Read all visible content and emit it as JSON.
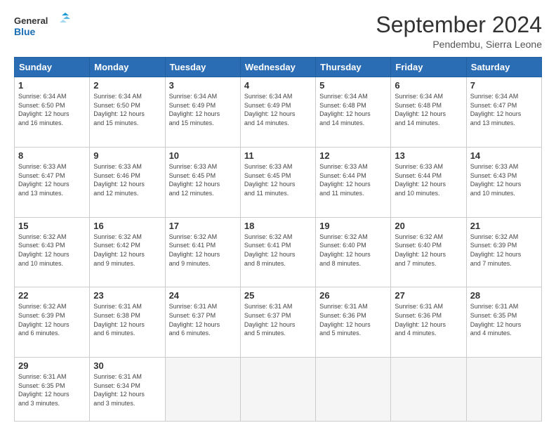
{
  "header": {
    "logo_line1": "General",
    "logo_line2": "Blue",
    "month": "September 2024",
    "location": "Pendembu, Sierra Leone"
  },
  "weekdays": [
    "Sunday",
    "Monday",
    "Tuesday",
    "Wednesday",
    "Thursday",
    "Friday",
    "Saturday"
  ],
  "weeks": [
    [
      {
        "day": "1",
        "info": "Sunrise: 6:34 AM\nSunset: 6:50 PM\nDaylight: 12 hours\nand 16 minutes."
      },
      {
        "day": "2",
        "info": "Sunrise: 6:34 AM\nSunset: 6:50 PM\nDaylight: 12 hours\nand 15 minutes."
      },
      {
        "day": "3",
        "info": "Sunrise: 6:34 AM\nSunset: 6:49 PM\nDaylight: 12 hours\nand 15 minutes."
      },
      {
        "day": "4",
        "info": "Sunrise: 6:34 AM\nSunset: 6:49 PM\nDaylight: 12 hours\nand 14 minutes."
      },
      {
        "day": "5",
        "info": "Sunrise: 6:34 AM\nSunset: 6:48 PM\nDaylight: 12 hours\nand 14 minutes."
      },
      {
        "day": "6",
        "info": "Sunrise: 6:34 AM\nSunset: 6:48 PM\nDaylight: 12 hours\nand 14 minutes."
      },
      {
        "day": "7",
        "info": "Sunrise: 6:34 AM\nSunset: 6:47 PM\nDaylight: 12 hours\nand 13 minutes."
      }
    ],
    [
      {
        "day": "8",
        "info": "Sunrise: 6:33 AM\nSunset: 6:47 PM\nDaylight: 12 hours\nand 13 minutes."
      },
      {
        "day": "9",
        "info": "Sunrise: 6:33 AM\nSunset: 6:46 PM\nDaylight: 12 hours\nand 12 minutes."
      },
      {
        "day": "10",
        "info": "Sunrise: 6:33 AM\nSunset: 6:45 PM\nDaylight: 12 hours\nand 12 minutes."
      },
      {
        "day": "11",
        "info": "Sunrise: 6:33 AM\nSunset: 6:45 PM\nDaylight: 12 hours\nand 11 minutes."
      },
      {
        "day": "12",
        "info": "Sunrise: 6:33 AM\nSunset: 6:44 PM\nDaylight: 12 hours\nand 11 minutes."
      },
      {
        "day": "13",
        "info": "Sunrise: 6:33 AM\nSunset: 6:44 PM\nDaylight: 12 hours\nand 10 minutes."
      },
      {
        "day": "14",
        "info": "Sunrise: 6:33 AM\nSunset: 6:43 PM\nDaylight: 12 hours\nand 10 minutes."
      }
    ],
    [
      {
        "day": "15",
        "info": "Sunrise: 6:32 AM\nSunset: 6:43 PM\nDaylight: 12 hours\nand 10 minutes."
      },
      {
        "day": "16",
        "info": "Sunrise: 6:32 AM\nSunset: 6:42 PM\nDaylight: 12 hours\nand 9 minutes."
      },
      {
        "day": "17",
        "info": "Sunrise: 6:32 AM\nSunset: 6:41 PM\nDaylight: 12 hours\nand 9 minutes."
      },
      {
        "day": "18",
        "info": "Sunrise: 6:32 AM\nSunset: 6:41 PM\nDaylight: 12 hours\nand 8 minutes."
      },
      {
        "day": "19",
        "info": "Sunrise: 6:32 AM\nSunset: 6:40 PM\nDaylight: 12 hours\nand 8 minutes."
      },
      {
        "day": "20",
        "info": "Sunrise: 6:32 AM\nSunset: 6:40 PM\nDaylight: 12 hours\nand 7 minutes."
      },
      {
        "day": "21",
        "info": "Sunrise: 6:32 AM\nSunset: 6:39 PM\nDaylight: 12 hours\nand 7 minutes."
      }
    ],
    [
      {
        "day": "22",
        "info": "Sunrise: 6:32 AM\nSunset: 6:39 PM\nDaylight: 12 hours\nand 6 minutes."
      },
      {
        "day": "23",
        "info": "Sunrise: 6:31 AM\nSunset: 6:38 PM\nDaylight: 12 hours\nand 6 minutes."
      },
      {
        "day": "24",
        "info": "Sunrise: 6:31 AM\nSunset: 6:37 PM\nDaylight: 12 hours\nand 6 minutes."
      },
      {
        "day": "25",
        "info": "Sunrise: 6:31 AM\nSunset: 6:37 PM\nDaylight: 12 hours\nand 5 minutes."
      },
      {
        "day": "26",
        "info": "Sunrise: 6:31 AM\nSunset: 6:36 PM\nDaylight: 12 hours\nand 5 minutes."
      },
      {
        "day": "27",
        "info": "Sunrise: 6:31 AM\nSunset: 6:36 PM\nDaylight: 12 hours\nand 4 minutes."
      },
      {
        "day": "28",
        "info": "Sunrise: 6:31 AM\nSunset: 6:35 PM\nDaylight: 12 hours\nand 4 minutes."
      }
    ],
    [
      {
        "day": "29",
        "info": "Sunrise: 6:31 AM\nSunset: 6:35 PM\nDaylight: 12 hours\nand 3 minutes."
      },
      {
        "day": "30",
        "info": "Sunrise: 6:31 AM\nSunset: 6:34 PM\nDaylight: 12 hours\nand 3 minutes."
      },
      {
        "day": "",
        "info": ""
      },
      {
        "day": "",
        "info": ""
      },
      {
        "day": "",
        "info": ""
      },
      {
        "day": "",
        "info": ""
      },
      {
        "day": "",
        "info": ""
      }
    ]
  ]
}
